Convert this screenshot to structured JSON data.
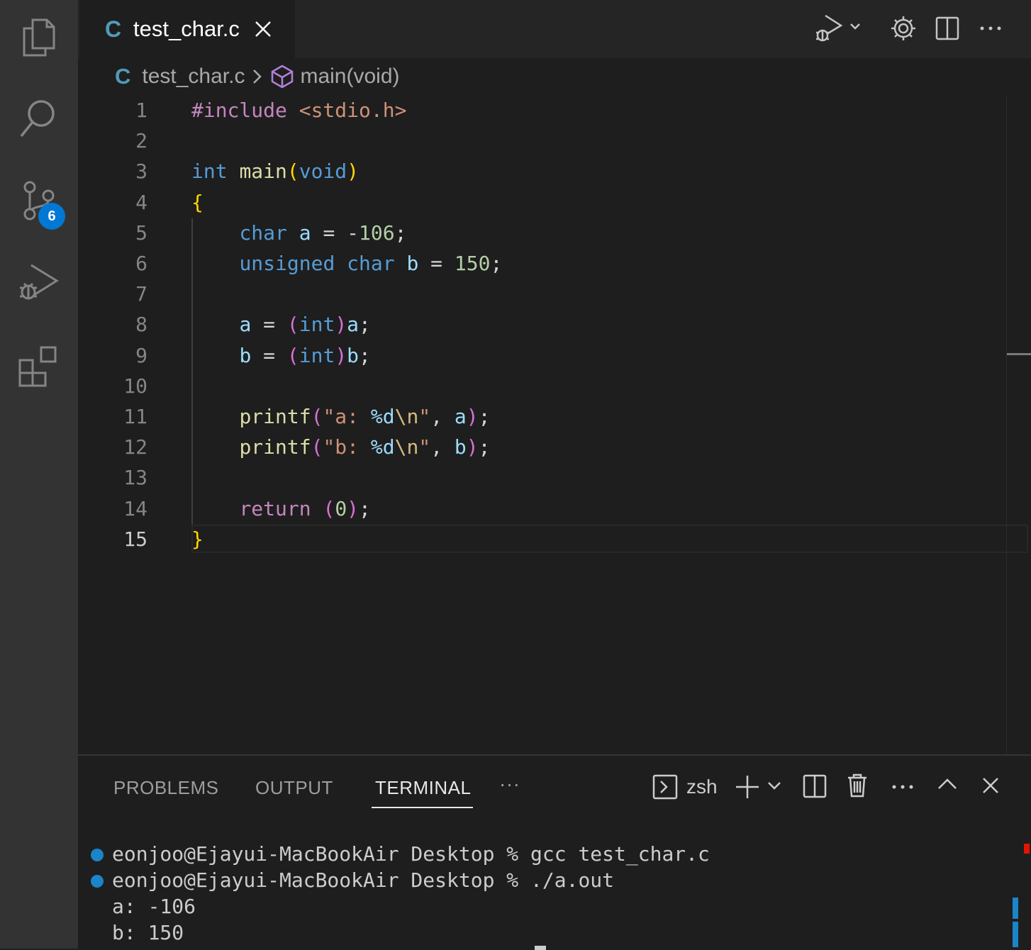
{
  "activity_bar": {
    "items": [
      "explorer-icon",
      "search-icon",
      "source-control-icon",
      "run-debug-icon",
      "extensions-icon"
    ],
    "source_control_badge": "6"
  },
  "tab": {
    "lang_icon": "C",
    "file": "test_char.c"
  },
  "breadcrumb": {
    "lang_icon": "C",
    "file": "test_char.c",
    "symbol": "main(void)"
  },
  "editor": {
    "line_numbers": [
      "1",
      "2",
      "3",
      "4",
      "5",
      "6",
      "7",
      "8",
      "9",
      "10",
      "11",
      "12",
      "13",
      "14",
      "15"
    ],
    "active_line": "15"
  },
  "panel": {
    "tabs": [
      "PROBLEMS",
      "OUTPUT",
      "TERMINAL"
    ],
    "active_tab": "TERMINAL",
    "more": "···",
    "shell": "zsh"
  },
  "terminal": {
    "lines": [
      "eonjoo@Ejayui-MacBookAir Desktop % gcc test_char.c",
      "eonjoo@Ejayui-MacBookAir Desktop % ./a.out",
      "a: -106",
      "b: 150"
    ]
  },
  "colors": {
    "accent": "#0078d4",
    "keyword": "#569cd6",
    "string": "#ce9178",
    "number": "#b5cea8",
    "function": "#dcdcaa"
  }
}
